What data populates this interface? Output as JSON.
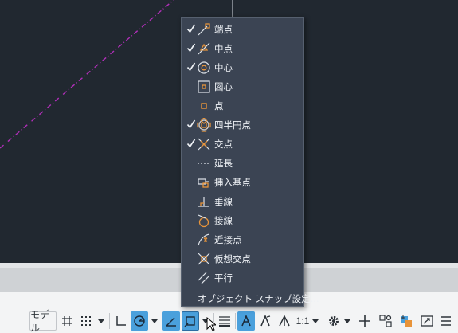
{
  "snap_menu": {
    "items": [
      {
        "label": "端点",
        "checked": true,
        "icon": "endpoint-icon"
      },
      {
        "label": "中点",
        "checked": true,
        "icon": "midpoint-icon"
      },
      {
        "label": "中心",
        "checked": true,
        "icon": "center-icon"
      },
      {
        "label": "図心",
        "checked": false,
        "icon": "centroid-icon"
      },
      {
        "label": "点",
        "checked": false,
        "icon": "node-icon"
      },
      {
        "label": "四半円点",
        "checked": true,
        "icon": "quadrant-icon"
      },
      {
        "label": "交点",
        "checked": true,
        "icon": "intersection-icon"
      },
      {
        "label": "延長",
        "checked": false,
        "icon": "extension-icon"
      },
      {
        "label": "挿入基点",
        "checked": false,
        "icon": "insertion-icon"
      },
      {
        "label": "垂線",
        "checked": false,
        "icon": "perpendicular-icon"
      },
      {
        "label": "接線",
        "checked": false,
        "icon": "tangent-icon"
      },
      {
        "label": "近接点",
        "checked": false,
        "icon": "nearest-icon"
      },
      {
        "label": "仮想交点",
        "checked": false,
        "icon": "apparent-intersection-icon"
      },
      {
        "label": "平行",
        "checked": false,
        "icon": "parallel-icon"
      }
    ],
    "settings_label": "オブジェクト スナップ設定..."
  },
  "statusbar": {
    "model_label": "モデル",
    "scale_label": "1:1"
  },
  "colors": {
    "canvas": "#212830",
    "menu_bg": "#3b4453",
    "accent": "#4aa0dc",
    "snap_marker": "#e8943a",
    "dashed_line": "#b02fb8"
  }
}
